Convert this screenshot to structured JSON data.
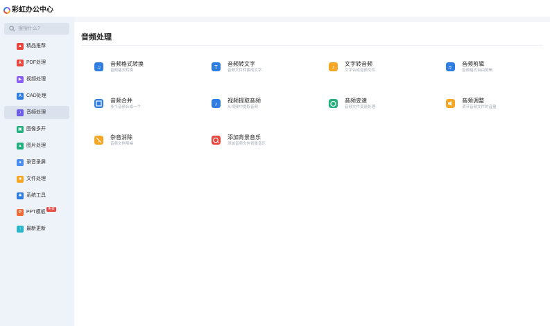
{
  "app": {
    "title": "彩虹办公中心",
    "logo_icon": "rainbow-logo-icon"
  },
  "search": {
    "placeholder": "搜搜什么?",
    "icon": "search-icon"
  },
  "sidebar": {
    "items": [
      {
        "label": "精品推荐",
        "icon": "recommend-icon",
        "color": "#e8453c",
        "active": false
      },
      {
        "label": "PDF处理",
        "icon": "pdf-icon",
        "color": "#e8453c",
        "active": false
      },
      {
        "label": "视频处理",
        "icon": "video-icon",
        "color": "#8b5cf6",
        "active": false
      },
      {
        "label": "CAD处理",
        "icon": "cad-icon",
        "color": "#2f7de1",
        "active": false
      },
      {
        "label": "音频处理",
        "icon": "audio-icon",
        "color": "#6d5ce8",
        "active": true
      },
      {
        "label": "图像多开",
        "icon": "multi-open-icon",
        "color": "#22b07d",
        "active": false
      },
      {
        "label": "图片处理",
        "icon": "image-icon",
        "color": "#22b07d",
        "active": false
      },
      {
        "label": "录音录屏",
        "icon": "microphone-icon",
        "color": "#4a8cf0",
        "active": false
      },
      {
        "label": "文件处理",
        "icon": "folder-icon",
        "color": "#f5a623",
        "active": false
      },
      {
        "label": "系统工具",
        "icon": "gear-icon",
        "color": "#2f7de1",
        "active": false
      },
      {
        "label": "PPT模板",
        "icon": "ppt-icon",
        "color": "#f06a35",
        "active": false,
        "badge": "免费"
      },
      {
        "label": "最新更新",
        "icon": "update-icon",
        "color": "#2bb5c8",
        "active": false
      }
    ]
  },
  "main": {
    "title": "音频处理",
    "tools": [
      {
        "title": "音频格式转换",
        "desc": "音频格式转换",
        "icon": "audio-convert-icon",
        "color": "#2f7de1"
      },
      {
        "title": "音频转文字",
        "desc": "音频文件转换成文字",
        "icon": "audio-to-text-icon",
        "color": "#2f7de1"
      },
      {
        "title": "文字转音频",
        "desc": "文字合成音频文件",
        "icon": "text-to-audio-icon",
        "color": "#f5a623"
      },
      {
        "title": "音频剪辑",
        "desc": "音频格式自由剪辑",
        "icon": "audio-cut-icon",
        "color": "#2f7de1"
      },
      {
        "title": "音频合并",
        "desc": "多个音频合成一个",
        "icon": "audio-merge-icon",
        "color": "#2f7de1"
      },
      {
        "title": "视频提取音频",
        "desc": "从视频中提取音频",
        "icon": "video-extract-audio-icon",
        "color": "#2f7de1"
      },
      {
        "title": "音频变速",
        "desc": "音频文件变速处理",
        "icon": "audio-speed-icon",
        "color": "#22b07d"
      },
      {
        "title": "音频调整",
        "desc": "调节音频文件的音量",
        "icon": "volume-icon",
        "color": "#f5a623"
      },
      {
        "title": "杂音消除",
        "desc": "音频文件降噪",
        "icon": "noise-remove-icon",
        "color": "#f5a623"
      },
      {
        "title": "添加背景音乐",
        "desc": "添加音频文件背景音乐",
        "icon": "add-bgm-icon",
        "color": "#e8453c"
      }
    ]
  }
}
